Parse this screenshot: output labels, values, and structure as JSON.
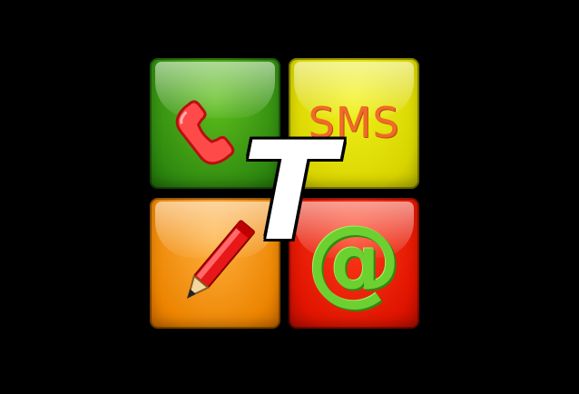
{
  "logo": {
    "tiles": {
      "phone": {
        "icon": "phone-handset-icon",
        "color": "#3a9a12"
      },
      "sms": {
        "label": "SMS",
        "color": "#e0dc00",
        "text_color": "#f06a2a"
      },
      "memo": {
        "icon": "pencil-icon",
        "color": "#ec8400"
      },
      "email": {
        "symbol": "@",
        "color": "#e01400",
        "symbol_color": "#6cd030"
      }
    },
    "center_letter": "T"
  }
}
